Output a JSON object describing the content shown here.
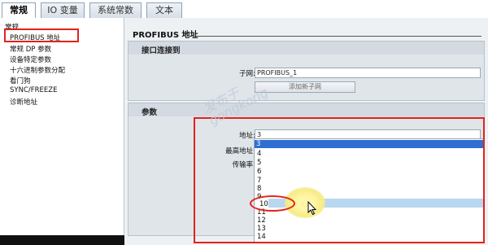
{
  "tabs": [
    {
      "label": "常规",
      "active": true
    },
    {
      "label": "IO 变量",
      "active": false
    },
    {
      "label": "系统常数",
      "active": false
    },
    {
      "label": "文本",
      "active": false
    }
  ],
  "tree": {
    "items": [
      {
        "label": "常规"
      },
      {
        "label": "PROFIBUS 地址"
      },
      {
        "label": "常规 DP 参数"
      },
      {
        "label": "设备特定参数"
      },
      {
        "label": "十六进制参数分配"
      },
      {
        "label": "看门狗"
      },
      {
        "label": "SYNC/FREEZE"
      },
      {
        "label": "诊断地址"
      }
    ]
  },
  "section": {
    "title": "PROFIBUS 地址"
  },
  "interface_panel": {
    "title": "接口连接到",
    "subnet_label": "子网:",
    "subnet_value": "PROFIBUS_1",
    "add_subnet_button": "添加新子网"
  },
  "params_panel": {
    "title": "参数",
    "address_label": "地址:",
    "address_value": "3",
    "highest_address_label": "最高地址:",
    "baud_label": "传输率:"
  },
  "dropdown": {
    "options": [
      "3",
      "4",
      "5",
      "6",
      "7",
      "8",
      "9",
      "10",
      "11",
      "12",
      "13",
      "14"
    ],
    "selected_index": 0,
    "hovered_index": 7
  },
  "watermark": {
    "line1": "发布于",
    "line2": "gongkong"
  },
  "colors": {
    "annotation_red": "#e2231a",
    "selection_blue": "#2e6fd1",
    "hover_blue": "#b9d7f0"
  },
  "icons": {
    "cursor": "mouse-pointer-icon"
  }
}
